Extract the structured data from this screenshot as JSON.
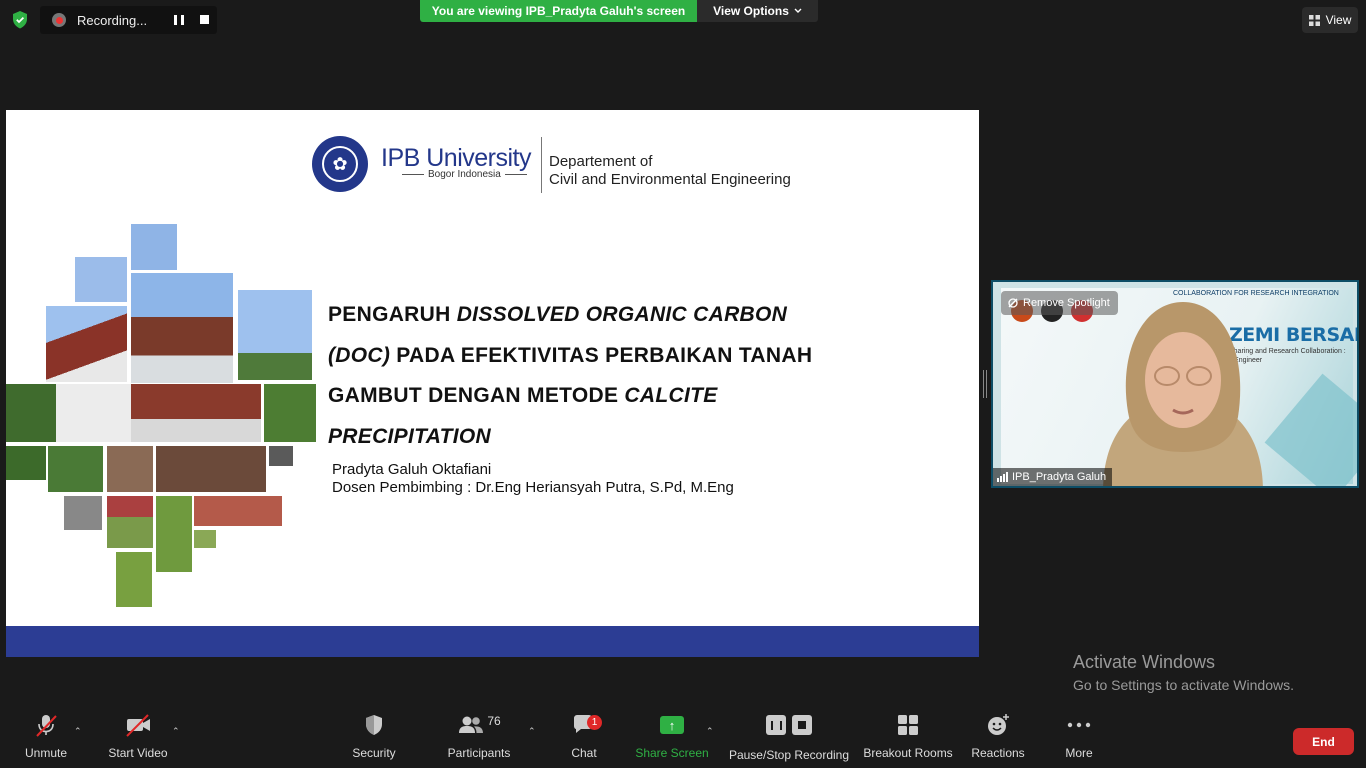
{
  "recording": {
    "label": "Recording..."
  },
  "banner": {
    "viewing": "You are viewing IPB_Pradyta Galuh's screen",
    "view_options": "View Options"
  },
  "view_button": {
    "label": "View"
  },
  "slide": {
    "university": "IPB University",
    "location": "Bogor Indonesia",
    "dept_line1": "Departement of",
    "dept_line2": "Civil and Environmental Engineering",
    "title_parts": {
      "p1": "PENGARUH ",
      "p2": "DISSOLVED ORGANIC CARBON",
      "p3": "(DOC)",
      "p4": " PADA EFEKTIVITAS PERBAIKAN TANAH GAMBUT DENGAN METODE ",
      "p5": "CALCITE PRECIPITATION"
    },
    "author": "Pradyta Galuh Oktafiani",
    "advisor": "Dosen Pembimbing : Dr.Eng Heriansyah Putra, S.Pd, M.Eng"
  },
  "video": {
    "participant_name": "IPB_Pradyta Galuh",
    "remove_spotlight": "Remove Spotlight",
    "banner_top": "COLLABORATION FOR RESEARCH INTEGRATION",
    "banner_title": "ZEMI BERSAMA",
    "banner_sub": "Sharing and Research Collaboration :",
    "banner_sub2": "il Engineer"
  },
  "watermark": {
    "line1": "Activate Windows",
    "line2": "Go to Settings to activate Windows."
  },
  "toolbar": {
    "unmute": "Unmute",
    "start_video": "Start Video",
    "security": "Security",
    "participants": "Participants",
    "participants_count": "76",
    "chat": "Chat",
    "chat_badge": "1",
    "share_screen": "Share Screen",
    "pause_stop": "Pause/Stop Recording",
    "breakout": "Breakout Rooms",
    "reactions": "Reactions",
    "more": "More",
    "end": "End"
  },
  "colors": {
    "share_green": "#2fb044",
    "end_red": "#cc2a2a",
    "ipb_blue": "#23378a",
    "slide_band": "#2c3d94"
  }
}
